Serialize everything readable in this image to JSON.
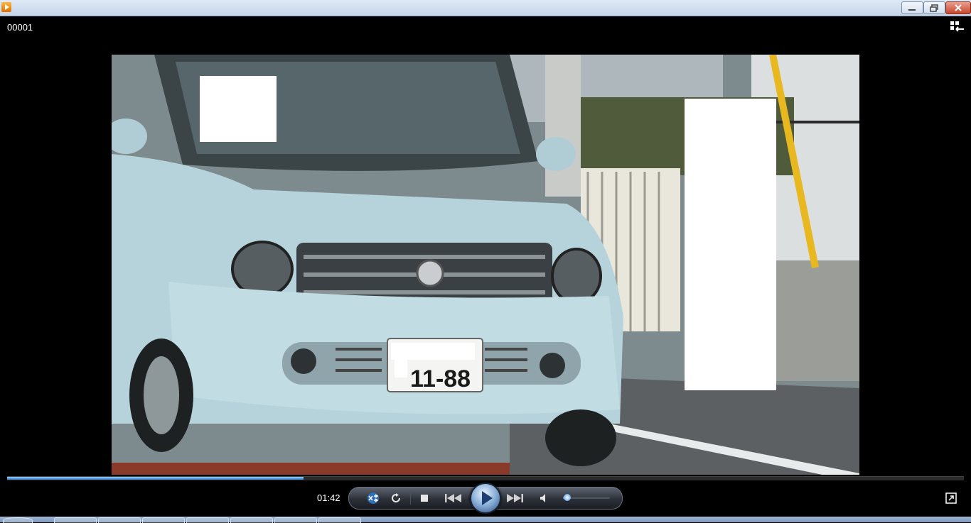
{
  "window": {
    "minimize_label": "minimize",
    "maximize_label": "restore",
    "close_label": "close"
  },
  "media": {
    "title": "00001",
    "plate_number": "11-88"
  },
  "playback": {
    "elapsed": "01:42",
    "progress_fraction": 0.31,
    "volume_fraction": 0.05,
    "state": "paused"
  },
  "icons": {
    "app": "media-player-icon",
    "switch_library": "switch-to-library-icon",
    "shuffle": "shuffle-icon",
    "repeat": "repeat-icon",
    "stop": "stop-icon",
    "previous": "previous-icon",
    "play": "play-icon",
    "next": "next-icon",
    "mute": "speaker-icon",
    "fullscreen": "fullscreen-icon"
  },
  "colors": {
    "accent": "#2f79c8",
    "background": "#000000"
  }
}
